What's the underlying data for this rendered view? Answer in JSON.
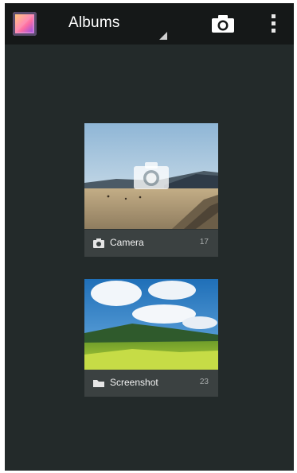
{
  "actionbar": {
    "app_icon": "gallery-app-icon",
    "title": "Albums",
    "spinner_icon": "spinner-arrow-icon",
    "camera_icon": "camera-icon",
    "overflow_icon": "overflow-menu-icon"
  },
  "albums": [
    {
      "name": "Camera",
      "count": "17",
      "icon": "camera-icon",
      "overlay_icon": "camera-overlay-icon"
    },
    {
      "name": "Screenshot",
      "count": "23",
      "icon": "folder-icon"
    }
  ],
  "colors": {
    "background": "#232a2a",
    "actionbar": "#151818",
    "album_label_bar": "#3b4141"
  }
}
